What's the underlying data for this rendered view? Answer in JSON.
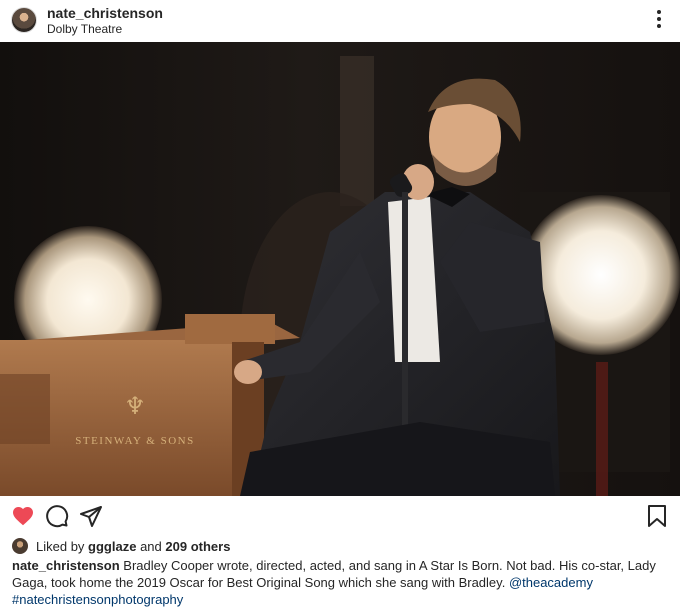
{
  "post": {
    "username": "nate_christenson",
    "location": "Dolby Theatre"
  },
  "photo": {
    "piano_brand": "STEINWAY & SONS"
  },
  "actions": {
    "like_icon": "heart-filled-icon",
    "comment_icon": "comment-icon",
    "share_icon": "send-icon",
    "save_icon": "bookmark-icon",
    "like_color": "#ed4956"
  },
  "likes": {
    "prefix": "Liked by",
    "user": "ggglaze",
    "connector": "and",
    "others": "209 others"
  },
  "caption": {
    "username": "nate_christenson",
    "text": "Bradley Cooper wrote, directed, acted, and sang in A Star Is Born. Not bad. His co-star, Lady Gaga, took home the 2019 Oscar for Best Original Song which she sang with Bradley.",
    "mention": "@theacademy",
    "hashtag": "#natechristensonphotography"
  }
}
